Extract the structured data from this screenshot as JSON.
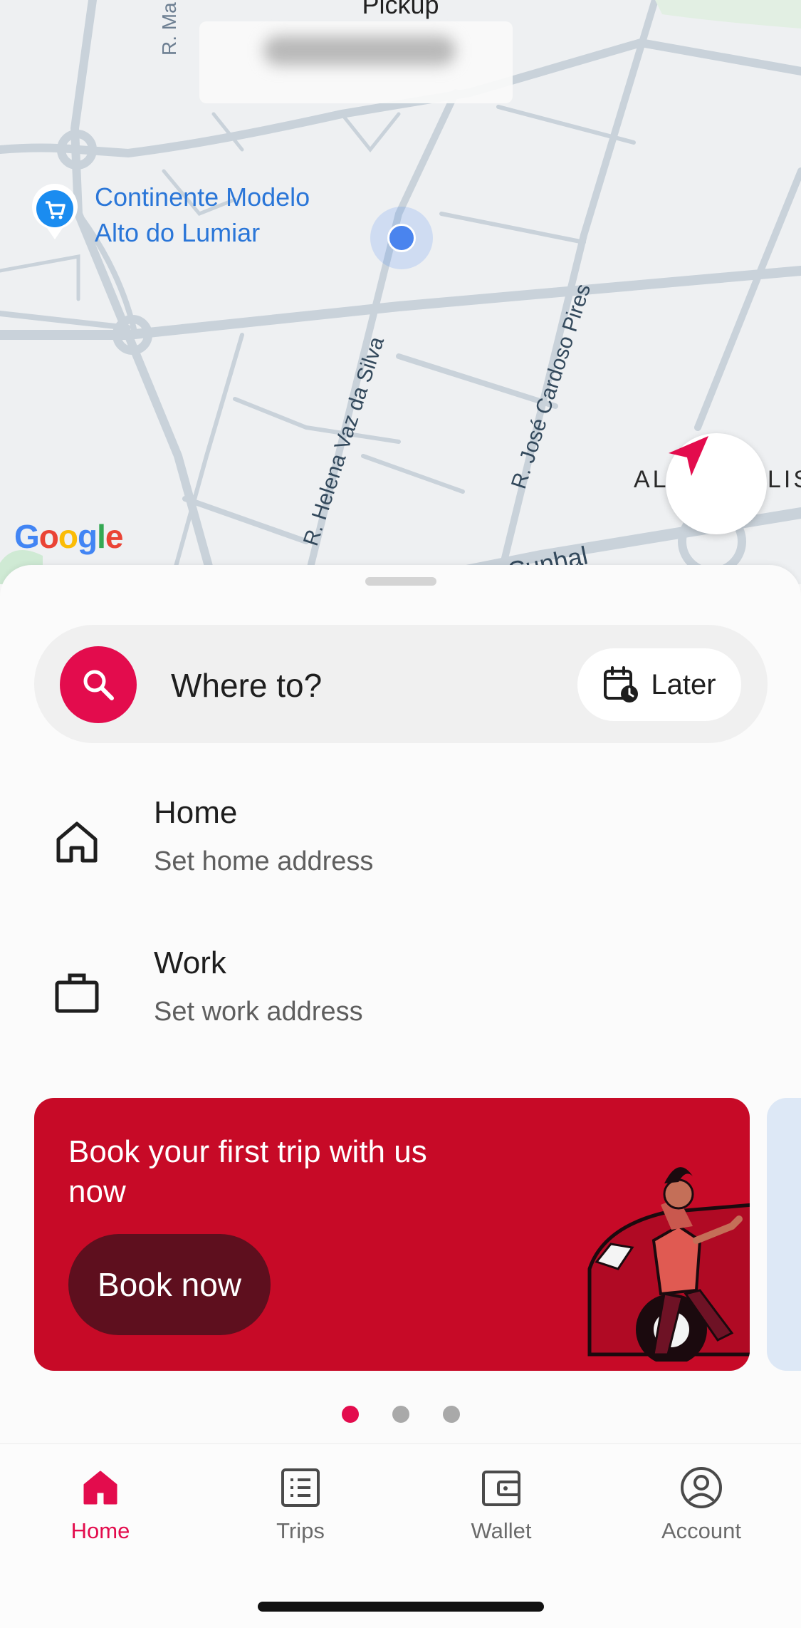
{
  "map": {
    "pickup_title": "Pickup",
    "poi_name_line1": "Continente Modelo",
    "poi_name_line2": "Alto do Lumiar",
    "streets": {
      "r_ma": "R. Ma",
      "helena": "R. Helena Vaz da Silva",
      "jose": "R. José Cardoso Pires",
      "cunhal": "Cunhal",
      "al": "AL",
      "lis": "LIS"
    },
    "google_logo": [
      "G",
      "o",
      "o",
      "g",
      "l",
      "e"
    ],
    "google_colors": [
      "#4285f4",
      "#ea4335",
      "#fbbc05",
      "#4285f4",
      "#34a853",
      "#ea4335"
    ]
  },
  "search": {
    "placeholder": "Where to?",
    "later_label": "Later"
  },
  "saved_places": [
    {
      "title": "Home",
      "subtitle": "Set home address",
      "icon": "home-icon"
    },
    {
      "title": "Work",
      "subtitle": "Set work address",
      "icon": "briefcase-icon"
    }
  ],
  "promo": {
    "title": "Book your first trip with us now",
    "button": "Book now",
    "color": "#c70a27"
  },
  "carousel": {
    "pages": 3,
    "active": 0
  },
  "tabs": [
    {
      "label": "Home",
      "icon": "home-filled-icon",
      "active": true
    },
    {
      "label": "Trips",
      "icon": "receipt-icon",
      "active": false
    },
    {
      "label": "Wallet",
      "icon": "wallet-icon",
      "active": false
    },
    {
      "label": "Account",
      "icon": "account-icon",
      "active": false
    }
  ],
  "accent": "#e30c4d"
}
